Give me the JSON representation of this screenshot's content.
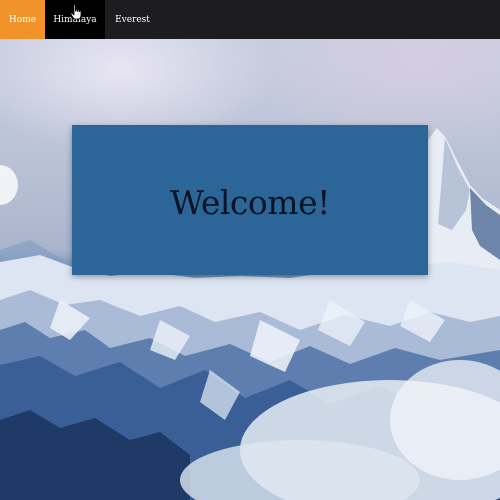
{
  "nav": {
    "items": [
      {
        "label": "Home",
        "state": "active"
      },
      {
        "label": "Himalaya",
        "state": "hover"
      },
      {
        "label": "Everest",
        "state": "default"
      }
    ],
    "colors": {
      "bar": "#1d1d1f",
      "active": "#f2932a",
      "hover": "#000000",
      "text": "#ffffff"
    }
  },
  "hero": {
    "title": "Welcome!",
    "box_color": "#2c6698",
    "title_color": "#0a1426"
  },
  "background": {
    "icon": "snowy-mountain-landscape"
  },
  "cursor": {
    "icon": "hand-pointer-cursor"
  }
}
